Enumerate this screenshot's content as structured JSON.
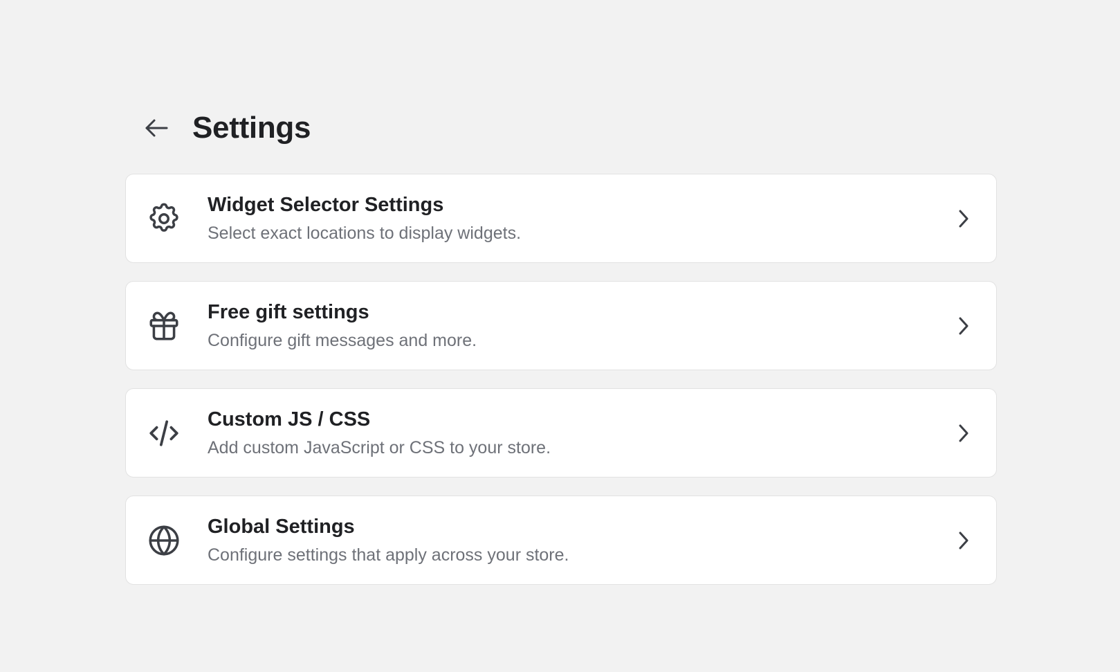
{
  "header": {
    "back_icon": "arrow-left-icon",
    "title": "Settings"
  },
  "settings_items": [
    {
      "icon": "gear-icon",
      "title": "Widget Selector Settings",
      "description": "Select exact locations to display widgets."
    },
    {
      "icon": "gift-icon",
      "title": "Free gift settings",
      "description": "Configure gift messages and more."
    },
    {
      "icon": "code-icon",
      "title": "Custom JS / CSS",
      "description": "Add custom JavaScript or CSS to your store."
    },
    {
      "icon": "globe-icon",
      "title": "Global Settings",
      "description": "Configure settings that apply across your store."
    }
  ],
  "colors": {
    "background": "#f2f2f2",
    "card": "#ffffff",
    "card_border": "#e2e2e2",
    "title_text": "#202124",
    "description_text": "#6e7178",
    "icon": "#3c3f45"
  }
}
